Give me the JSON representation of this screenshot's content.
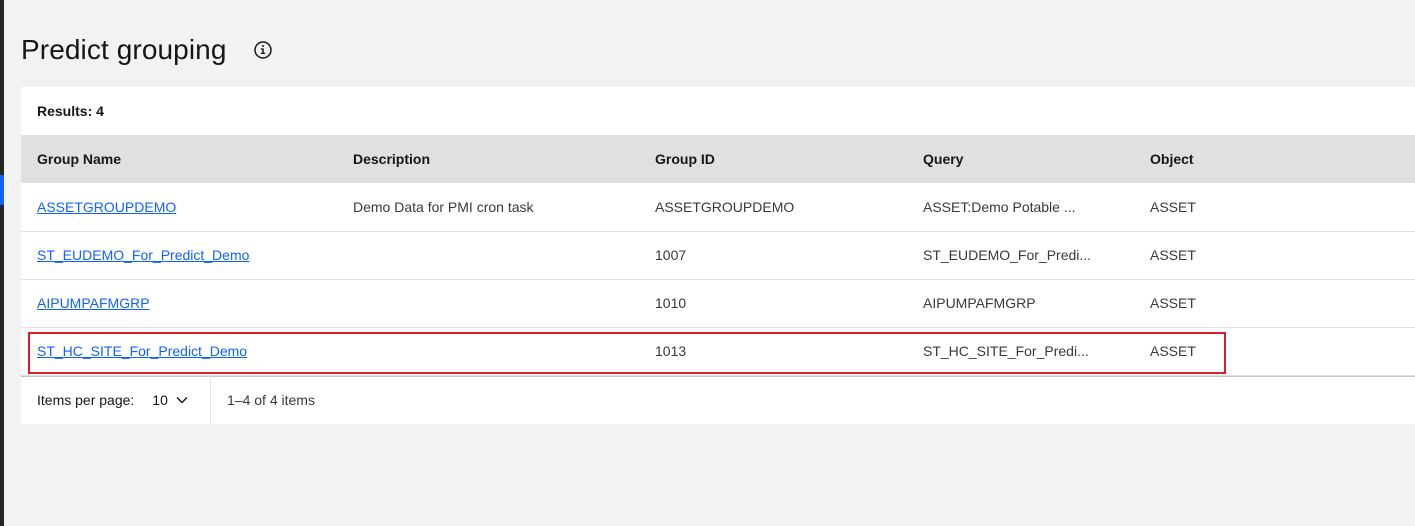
{
  "page": {
    "title": "Predict grouping",
    "info_icon": "info-icon"
  },
  "results": {
    "label": "Results: 4"
  },
  "table": {
    "columns": [
      "Group Name",
      "Description",
      "Group ID",
      "Query",
      "Object"
    ],
    "rows": [
      {
        "name": "ASSETGROUPDEMO",
        "description": "Demo Data for PMI cron task",
        "group_id": "ASSETGROUPDEMO",
        "query": "ASSET:Demo Potable ...",
        "object": "ASSET"
      },
      {
        "name": "ST_EUDEMO_For_Predict_Demo",
        "description": "",
        "group_id": "1007",
        "query": "ST_EUDEMO_For_Predi...",
        "object": "ASSET"
      },
      {
        "name": "AIPUMPAFMGRP",
        "description": "",
        "group_id": "1010",
        "query": "AIPUMPAFMGRP",
        "object": "ASSET"
      },
      {
        "name": "ST_HC_SITE_For_Predict_Demo",
        "description": "",
        "group_id": "1013",
        "query": "ST_HC_SITE_For_Predi...",
        "object": "ASSET"
      }
    ]
  },
  "pagination": {
    "items_per_page_label": "Items per page:",
    "items_per_page_value": "10",
    "range_text": "1–4 of 4 items"
  },
  "colors": {
    "link": "#0f62fe",
    "highlight": "#da1e28",
    "header_bg": "#e0e0e0",
    "page_bg": "#f2f2f2"
  }
}
